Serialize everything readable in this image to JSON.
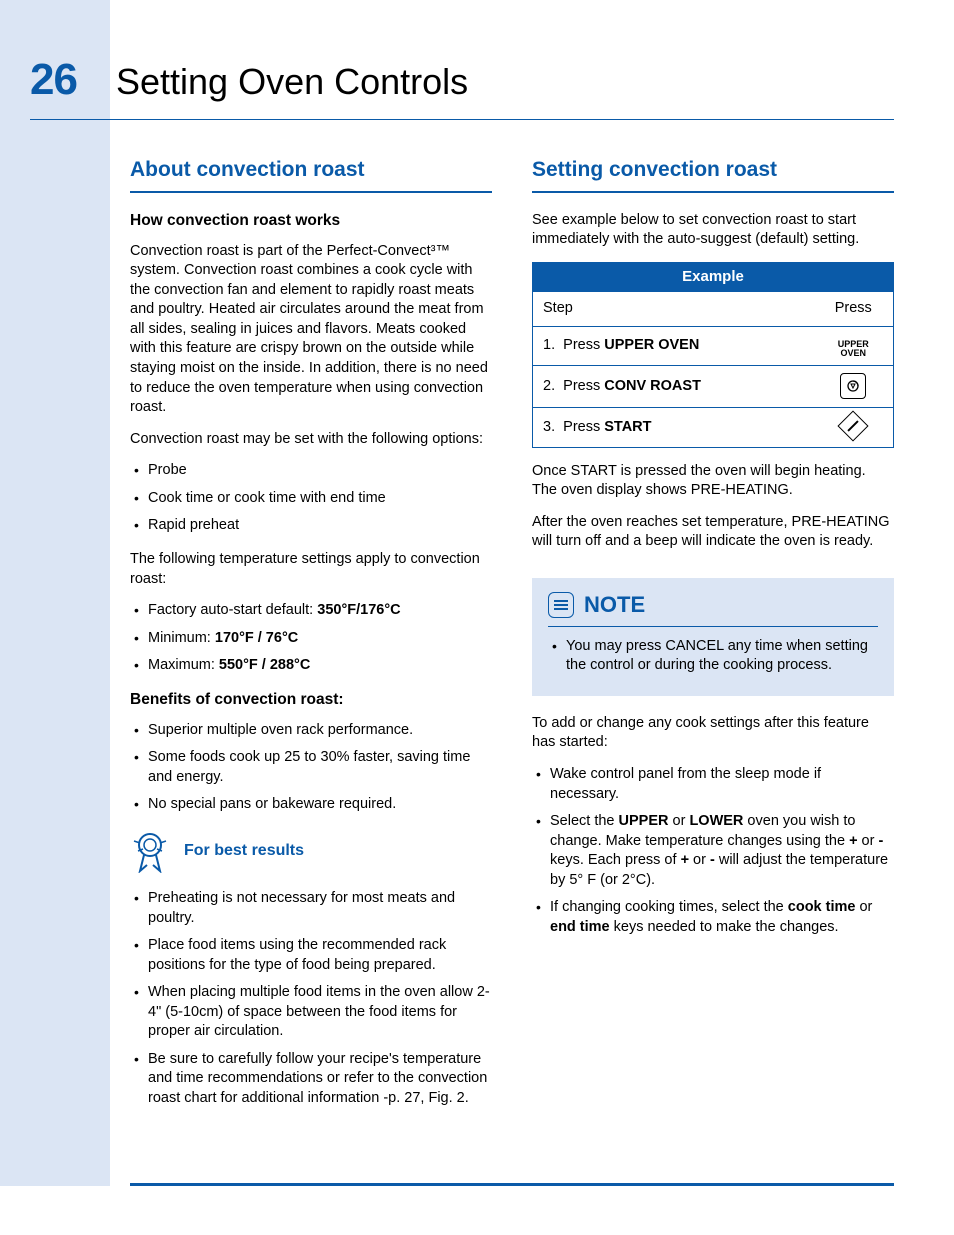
{
  "page_number": "26",
  "page_title": "Setting Oven Controls",
  "left": {
    "heading": "About convection roast",
    "sub1": "How convection roast works",
    "p1": "Convection roast is part of the Perfect-Convect³™ system. Convection roast combines a cook cycle with the convection fan and element to rapidly roast meats and poultry. Heated air circulates around the meat from all sides, sealing in juices and flavors. Meats cooked with this feature are crispy brown on the outside while staying moist on the inside. In addition, there is no need to reduce the oven temperature when using convection roast.",
    "p2": "Convection roast may be set with the following options:",
    "opts": [
      "Probe",
      "Cook time or cook time with end time",
      "Rapid preheat"
    ],
    "p3": "The following temperature settings apply to convection roast:",
    "temps": [
      {
        "label": "Factory auto-start default: ",
        "val": "350°F/176°C"
      },
      {
        "label": "Minimum: ",
        "val": "170°F / 76°C"
      },
      {
        "label": "Maximum: ",
        "val": "550°F / 288°C"
      }
    ],
    "sub2": "Benefits of convection roast:",
    "benefits": [
      "Superior multiple oven rack performance.",
      "Some foods cook up 25 to 30% faster, saving time and energy.",
      "No special pans or bakeware required."
    ],
    "best_title": "For best results",
    "best": [
      "Preheating is not necessary for most meats and poultry.",
      "Place food items using the recommended rack positions for the type of food being prepared.",
      "When placing multiple food items in the oven allow 2-4\" (5-10cm) of space between the food items for proper air circulation.",
      "Be sure to carefully follow your recipe's temperature and time recommendations or refer to the convection roast chart for additional information -p. 27, Fig. 2."
    ]
  },
  "right": {
    "heading": "Setting convection roast",
    "p1": "See example below to set convection roast to start immediately with the auto-suggest (default) setting.",
    "table": {
      "title": "Example",
      "col_step": "Step",
      "col_press": "Press",
      "rows": [
        {
          "num": "1.",
          "pre": "Press ",
          "bold": "UPPER OVEN",
          "icon": "upper"
        },
        {
          "num": "2.",
          "pre": "Press ",
          "bold": "CONV ROAST",
          "icon": "conv"
        },
        {
          "num": "3.",
          "pre": "Press ",
          "bold": "START",
          "icon": "start"
        }
      ]
    },
    "p2": "Once START is pressed the oven will begin heating. The oven display shows PRE-HEATING.",
    "p3": "After the oven reaches set temperature, PRE-HEATING will turn off and a beep will indicate the oven is ready.",
    "note_title": "NOTE",
    "note_items": [
      "You may press CANCEL any time when setting the control or during the cooking process."
    ],
    "p4": "To add or change any cook settings after this feature has started:",
    "change": [
      "Wake control panel from the sleep mode if necessary.",
      "Select the UPPER or LOWER oven you wish to change. Make temperature changes using the + or - keys. Each press of + or - will adjust the temperature by 5° F (or 2°C).",
      "If changing cooking times, select the cook time or end time keys needed to make the changes."
    ],
    "upper_icon_l1": "UPPER",
    "upper_icon_l2": "OVEN"
  }
}
